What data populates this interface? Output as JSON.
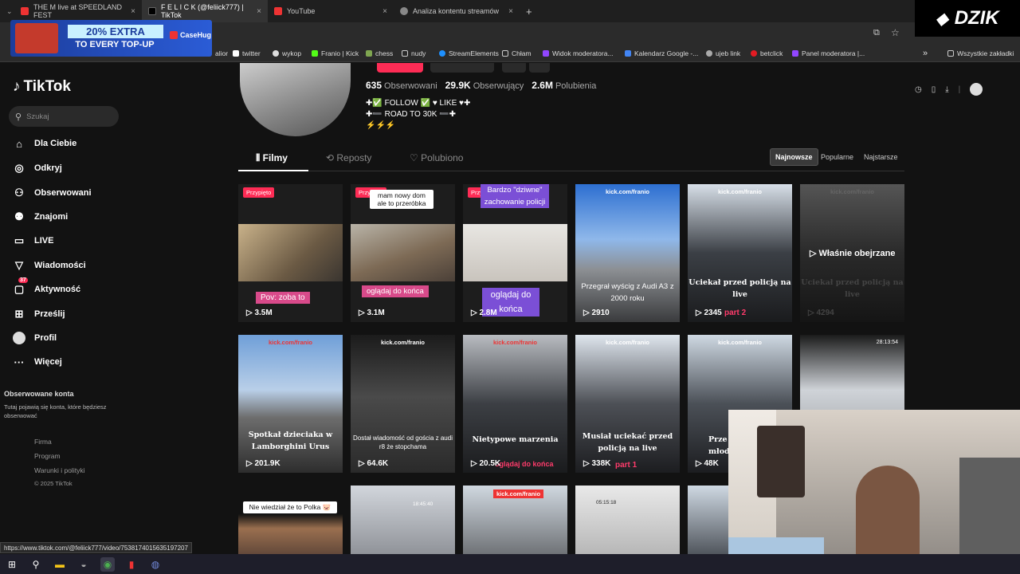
{
  "browser": {
    "tabs": [
      {
        "title": "THE M live at SPEEDLAND FEST",
        "close": "×"
      },
      {
        "title": "F E L I C K (@feliick777) | TikTok",
        "close": "×"
      },
      {
        "title": "YouTube",
        "close": "×"
      },
      {
        "title": "Analiza kontentu streamów",
        "close": "×"
      }
    ],
    "new_tab": "+",
    "bookmarks": [
      "alior",
      "twitter",
      "wykop",
      "Franio | Kick",
      "chess",
      "nudy",
      "StreamElements",
      "Chłam",
      "Widok moderatora...",
      "Kalendarz Google -...",
      "ujeb link",
      "betclick",
      "Panel moderatora |..."
    ],
    "bookmarks_more": "»",
    "all_bookmarks": "Wszystkie zakładki",
    "status_url": "https://www.tiktok.com/@feliick777/video/7538174015635197207"
  },
  "overlay": {
    "promo_line1": "20% EXTRA",
    "promo_line2": "TO EVERY TOP-UP",
    "promo_brand": "CaseHug",
    "dzik": "DZIK"
  },
  "sidebar": {
    "logo": "TikTok",
    "search_placeholder": "Szukaj",
    "nav": [
      {
        "label": "Dla Ciebie",
        "icon": "home-icon"
      },
      {
        "label": "Odkryj",
        "icon": "compass-icon"
      },
      {
        "label": "Obserwowani",
        "icon": "following-icon"
      },
      {
        "label": "Znajomi",
        "icon": "friends-icon"
      },
      {
        "label": "LIVE",
        "icon": "live-icon"
      },
      {
        "label": "Wiadomości",
        "icon": "messages-icon"
      },
      {
        "label": "Aktywność",
        "icon": "activity-icon",
        "badge": "37"
      },
      {
        "label": "Prześlij",
        "icon": "upload-icon"
      },
      {
        "label": "Profil",
        "icon": "profile-icon"
      },
      {
        "label": "Więcej",
        "icon": "more-icon"
      }
    ],
    "followed_heading": "Obserwowane konta",
    "followed_text": "Tutaj pojawią się konta, które będziesz obserwować",
    "footer": [
      "Firma",
      "Program",
      "Warunki i polityki",
      "© 2025 TikTok"
    ]
  },
  "profile": {
    "following_count": "635",
    "following_label": "Obserwowani",
    "followers_count": "29.9K",
    "followers_label": "Obserwujący",
    "likes_count": "2.6M",
    "likes_label": "Polubienia",
    "bio": [
      "✚✅ FOLLOW ✅ ♥ LIKE ♥✚",
      "✚➖ ROAD TO 30K ➖✚",
      "⚡⚡⚡"
    ],
    "tabs": [
      "Filmy",
      "Reposty",
      "Polubiono"
    ],
    "sort": [
      "Najnowsze",
      "Popularne",
      "Najstarsze"
    ]
  },
  "videos": [
    {
      "views": "3.5M",
      "pinned": "Przypięto",
      "tag": "Pov: zoba to"
    },
    {
      "views": "3.1M",
      "pinned": "Przypięto",
      "box": "mam nowy dom ale to przeróbka",
      "tag": "oglądaj do końca"
    },
    {
      "views": "2.8M",
      "pinned": "Przypięto",
      "top": "Bardzo \"dziwne\" zachowanie policji",
      "tag": "oglądaj do końca"
    },
    {
      "views": "2910",
      "kick": "kick.com/franio",
      "caption": "Przegrał wyścig z Audi A3 z 2000 roku"
    },
    {
      "views": "2345",
      "kick": "kick.com/franio",
      "caption": "Uciekał przed policją na live",
      "part": "part 2"
    },
    {
      "views": "4294",
      "kick": "kick.com/franio",
      "caption": "Uciekał przed policją na live",
      "watched": "Właśnie obejrzane"
    },
    {
      "views": "201.9K",
      "kick": "kick.com/franio",
      "caption": "Spotkał dzieciaka w Lamborghini Urus"
    },
    {
      "views": "64.6K",
      "kick": "kick.com/franio",
      "caption": "Dostał wiadomość od gościa z audi r8 że stopchama"
    },
    {
      "views": "20.5K",
      "kick": "kick.com/franio",
      "caption": "Nietypowe marzenia",
      "part": "oglądaj do końca"
    },
    {
      "views": "338K",
      "kick": "kick.com/franio",
      "caption": "Musiał uciekać przed policją na live",
      "part": "part 1"
    },
    {
      "views": "48K",
      "kick": "kick.com/franio",
      "caption": "Prze młod"
    },
    {
      "views": "",
      "timer": "28:13:54"
    },
    {
      "views": "",
      "box": "Nie wiedział że to Polka 🐷"
    },
    {
      "views": "",
      "timer": "18:45:40"
    },
    {
      "views": "",
      "kick": "kick.com/franio"
    },
    {
      "views": "",
      "timer": "05:15:18"
    },
    {
      "views": ""
    }
  ]
}
